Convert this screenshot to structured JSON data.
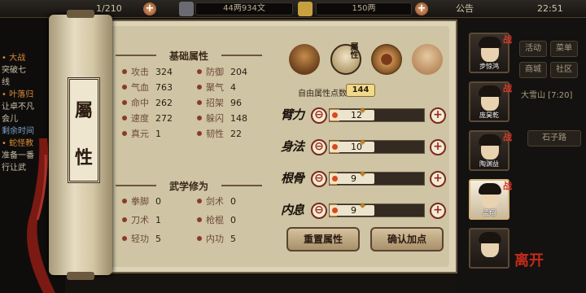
{
  "topbar": {
    "counter": "1/210",
    "silver": "44两934文",
    "gold": "150两",
    "notice": "公告",
    "time": "22:51"
  },
  "leftlog": [
    {
      "text": "• 大战",
      "color": "#d98a3a"
    },
    {
      "text": "突破七",
      "color": "#c9c0a8"
    },
    {
      "text": "线",
      "color": "#c9c0a8"
    },
    {
      "text": "• 叶落归",
      "color": "#d98a3a"
    },
    {
      "text": "让卓不凡",
      "color": "#c9c0a8"
    },
    {
      "text": "会儿",
      "color": "#c9c0a8"
    },
    {
      "text": "剩余时间",
      "color": "#7aa0c8"
    },
    {
      "text": "• 蛇怪教",
      "color": "#d98a3a"
    },
    {
      "text": "准备一番",
      "color": "#c9c0a8"
    },
    {
      "text": "行让武",
      "color": "#c9c0a8"
    }
  ],
  "rightbg": {
    "buttons": [
      "活动",
      "菜单",
      "商城",
      "社区"
    ],
    "location": "大雪山 [7:20]",
    "road": "石子路"
  },
  "scroll": {
    "title_top": "屬",
    "title_bottom": "性"
  },
  "base": {
    "title": "基础属性",
    "stats": [
      {
        "name": "攻击",
        "value": "324"
      },
      {
        "name": "防御",
        "value": "204"
      },
      {
        "name": "气血",
        "value": "763"
      },
      {
        "name": "聚气",
        "value": "4"
      },
      {
        "name": "命中",
        "value": "262"
      },
      {
        "name": "招架",
        "value": "96"
      },
      {
        "name": "速度",
        "value": "272"
      },
      {
        "name": "躲闪",
        "value": "148"
      },
      {
        "name": "真元",
        "value": "1"
      },
      {
        "name": "韧性",
        "value": "22"
      }
    ]
  },
  "martial": {
    "title": "武学修为",
    "stats": [
      {
        "name": "拳脚",
        "value": "0"
      },
      {
        "name": "剑术",
        "value": "0"
      },
      {
        "name": "刀术",
        "value": "1"
      },
      {
        "name": "枪棍",
        "value": "0"
      },
      {
        "name": "轻功",
        "value": "5"
      },
      {
        "name": "内功",
        "value": "5"
      }
    ]
  },
  "tabs": {
    "active_label": "屬性"
  },
  "free_points": {
    "label": "自由属性点数",
    "value": "144"
  },
  "attributes": [
    {
      "label": "臂力",
      "value": "12",
      "fill": 0.1
    },
    {
      "label": "身法",
      "value": "10",
      "fill": 0.1
    },
    {
      "label": "根骨",
      "value": "9",
      "fill": 0.08
    },
    {
      "label": "内息",
      "value": "9",
      "fill": 0.08
    }
  ],
  "buttons": {
    "reset": "重置属性",
    "confirm": "确认加点"
  },
  "party": [
    {
      "name": "步惊鸿",
      "tag": "战"
    },
    {
      "name": "庞昊乾",
      "tag": "战"
    },
    {
      "name": "陶渊益",
      "tag": "战"
    },
    {
      "name": "孟翔",
      "tag": "战"
    },
    {
      "name": "",
      "tag": ""
    }
  ],
  "stamp": "离开"
}
